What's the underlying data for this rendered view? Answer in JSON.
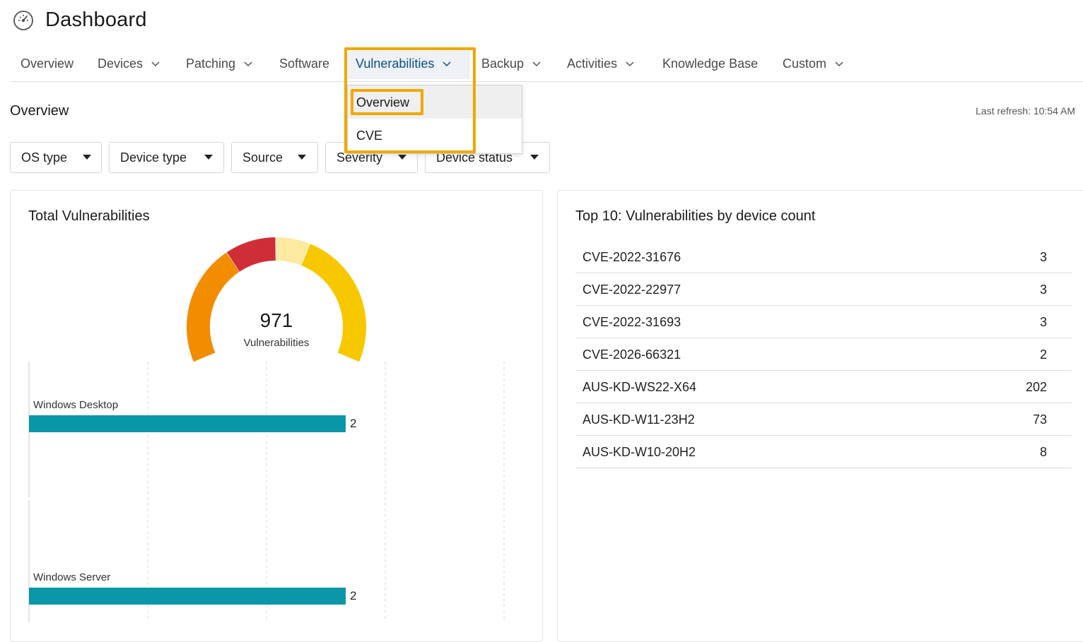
{
  "header": {
    "title": "Dashboard",
    "icon": "speedometer-icon"
  },
  "nav": {
    "items": [
      {
        "label": "Overview",
        "has_chevron": false
      },
      {
        "label": "Devices",
        "has_chevron": true
      },
      {
        "label": "Patching",
        "has_chevron": true
      },
      {
        "label": "Software",
        "has_chevron": false
      },
      {
        "label": "Vulnerabilities",
        "has_chevron": true,
        "active": true
      },
      {
        "label": "Backup",
        "has_chevron": true
      },
      {
        "label": "Activities",
        "has_chevron": true
      },
      {
        "label": "Knowledge Base",
        "has_chevron": false
      },
      {
        "label": "Custom",
        "has_chevron": true
      }
    ],
    "active_color": "#0b4f8c"
  },
  "dropdown": {
    "items": [
      {
        "label": "Overview",
        "selected": true
      },
      {
        "label": "CVE",
        "selected": false
      }
    ]
  },
  "page": {
    "section_title": "Overview",
    "last_refresh": "Last refresh: 10:54 AM"
  },
  "filters": [
    "OS type",
    "Device type",
    "Source",
    "Severity",
    "Device status"
  ],
  "total_card": {
    "title": "Total Vulnerabilities",
    "count": "971",
    "count_label": "Vulnerabilities",
    "donut_colors": [
      "#f28c00",
      "#cf2e36",
      "#fde9a0",
      "#f7c800"
    ],
    "bar_color": "#0a97a8",
    "bars": [
      {
        "label": "Windows Desktop",
        "value": "2"
      },
      {
        "label": "Windows Server",
        "value": "2"
      }
    ]
  },
  "top10_card": {
    "title": "Top 10: Vulnerabilities by device count",
    "rows": [
      {
        "name": "CVE-2022-31676",
        "count": "3"
      },
      {
        "name": "CVE-2022-22977",
        "count": "3"
      },
      {
        "name": "CVE-2022-31693",
        "count": "3"
      },
      {
        "name": "CVE-2026-66321",
        "count": "2"
      },
      {
        "name": "AUS-KD-WS22-X64",
        "count": "202"
      },
      {
        "name": "AUS-KD-W11-23H2",
        "count": "73"
      },
      {
        "name": "AUS-KD-W10-20H2",
        "count": "8"
      }
    ]
  },
  "highlight_color": "#f0a800"
}
